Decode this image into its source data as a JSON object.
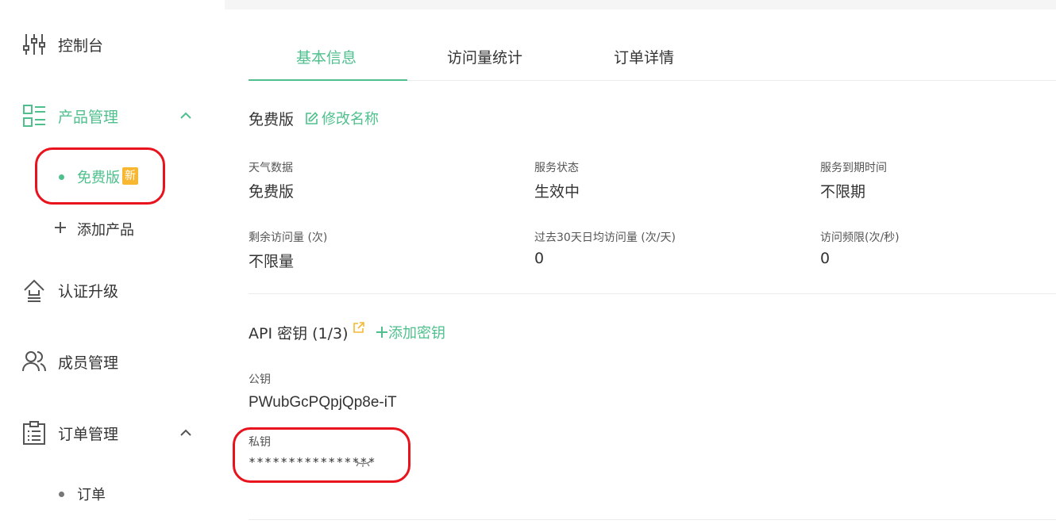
{
  "sidebar": {
    "items": [
      {
        "label": "控制台",
        "icon": "sliders-icon"
      },
      {
        "label": "产品管理",
        "icon": "layout-icon",
        "expanded": true,
        "active": true
      },
      {
        "label": "认证升级",
        "icon": "upgrade-icon"
      },
      {
        "label": "成员管理",
        "icon": "users-icon"
      },
      {
        "label": "订单管理",
        "icon": "clipboard-icon",
        "expanded": true
      }
    ],
    "product_subitems": {
      "free_plan": {
        "label": "免费版",
        "badge": "新"
      },
      "add_product": {
        "label": "添加产品"
      }
    },
    "order_subitems": {
      "orders": {
        "label": "订单"
      }
    }
  },
  "tabs": [
    {
      "label": "基本信息",
      "active": true
    },
    {
      "label": "访问量统计"
    },
    {
      "label": "订单详情"
    }
  ],
  "plan": {
    "name": "免费版",
    "rename_label": "修改名称"
  },
  "stats": {
    "weather_data": {
      "label": "天气数据",
      "value": "免费版"
    },
    "service_status": {
      "label": "服务状态",
      "value": "生效中"
    },
    "expiry": {
      "label": "服务到期时间",
      "value": "不限期"
    },
    "remaining": {
      "label": "剩余访问量 (次)",
      "value": "不限量"
    },
    "avg_30d": {
      "label": "过去30天日均访问量 (次/天)",
      "value": "0"
    },
    "rate_limit": {
      "label": "访问频限(次/秒)",
      "value": "0"
    }
  },
  "api": {
    "title": "API 密钥 (1/3)",
    "add_key_label": "添加密钥",
    "public_key_label": "公钥",
    "public_key": "PWubGcPQpjQp8e-iT",
    "private_key_label": "私钥",
    "private_key_masked": "****************"
  },
  "colors": {
    "accent": "#4fc08d",
    "badge": "#f7b731",
    "annotation": "#e8131d"
  }
}
